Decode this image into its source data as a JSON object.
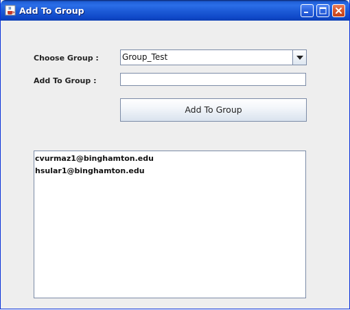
{
  "window": {
    "title": "Add To Group",
    "titlebar_color": "#0c4ad0",
    "close_color": "#d9582e"
  },
  "form": {
    "choose_group_label": "Choose Group  :",
    "choose_group_value": "Group_Test",
    "add_to_group_label": "Add To Group  :",
    "add_to_group_value": "",
    "add_button_label": "Add To Group"
  },
  "members": [
    {
      "email": "cvurmaz1@binghamton.edu"
    },
    {
      "email": "hsular1@binghamton.edu"
    }
  ],
  "icons": {
    "app": "java-cup-icon",
    "minimize": "minimize-icon",
    "maximize": "maximize-icon",
    "close": "close-icon",
    "dropdown": "chevron-down-icon"
  }
}
